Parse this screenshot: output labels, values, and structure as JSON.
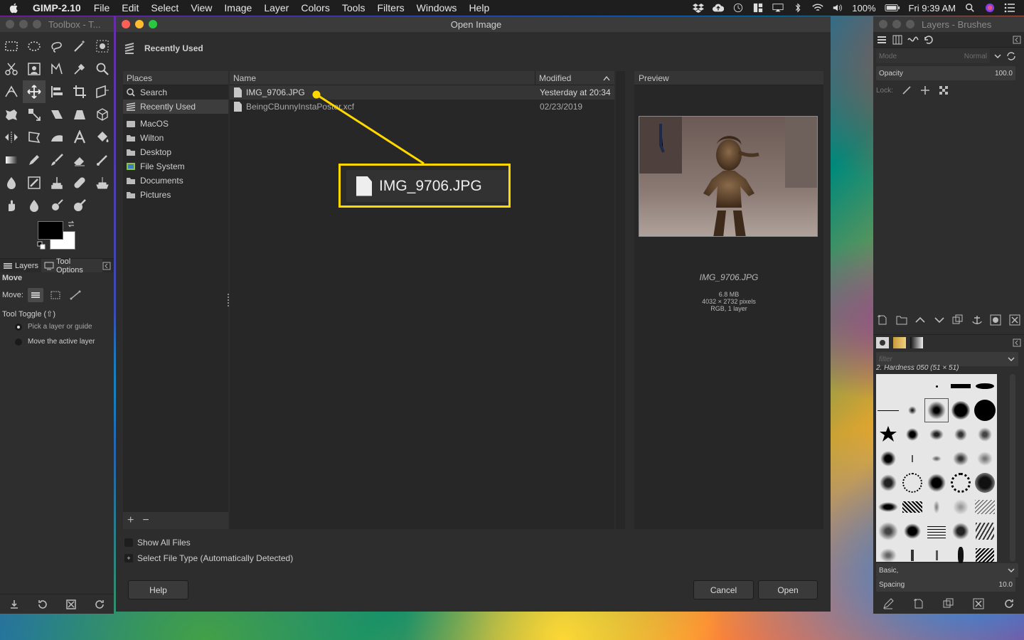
{
  "menubar": {
    "app_name": "GIMP-2.10",
    "items": [
      "File",
      "Edit",
      "Select",
      "View",
      "Image",
      "Layer",
      "Colors",
      "Tools",
      "Filters",
      "Windows",
      "Help"
    ],
    "battery": "100%",
    "clock": "Fri 9:39 AM"
  },
  "toolbox": {
    "title": "Toolbox - T...",
    "tabs": {
      "layers": "Layers",
      "tool_options": "Tool Options"
    },
    "tool_name": "Move",
    "move_label": "Move:",
    "tool_toggle": "Tool Toggle  (⇧)",
    "option_pick": "Pick a layer or guide",
    "option_move_active": "Move the active layer"
  },
  "dialog": {
    "title": "Open Image",
    "location": "Recently Used",
    "places_header": "Places",
    "places": [
      {
        "label": "Search",
        "icon": "search-icon"
      },
      {
        "label": "Recently Used",
        "icon": "recent-icon",
        "selected": true
      },
      {
        "label": "MacOS",
        "icon": "drive-icon"
      },
      {
        "label": "Wilton",
        "icon": "folder-icon"
      },
      {
        "label": "Desktop",
        "icon": "folder-icon"
      },
      {
        "label": "File System",
        "icon": "filesystem-icon"
      },
      {
        "label": "Documents",
        "icon": "folder-icon"
      },
      {
        "label": "Pictures",
        "icon": "folder-icon"
      }
    ],
    "columns": {
      "name": "Name",
      "modified": "Modified"
    },
    "files": [
      {
        "name": "IMG_9706.JPG",
        "modified": "Yesterday at 20:34"
      },
      {
        "name": "BeingCBunnyInstaPoster.xcf",
        "modified": "02/23/2019"
      }
    ],
    "preview_header": "Preview",
    "preview": {
      "name": "IMG_9706.JPG",
      "size": "6.8 MB",
      "dimensions": "4032 × 2732 pixels",
      "mode": "RGB, 1 layer"
    },
    "show_all_files": "Show All Files",
    "select_file_type": "Select File Type (Automatically Detected)",
    "help_button": "Help",
    "cancel_button": "Cancel",
    "open_button": "Open"
  },
  "callout": {
    "text": "IMG_9706.JPG",
    "color": "#ffd800"
  },
  "layers": {
    "title": "Layers - Brushes",
    "mode_label": "Mode",
    "mode_value": "Normal",
    "opacity_label": "Opacity",
    "opacity_value": "100.0",
    "lock_label": "Lock:",
    "filter_placeholder": "filter",
    "brush_name": "2. Hardness 050 (51 × 51)",
    "brush_set": "Basic,",
    "spacing_label": "Spacing",
    "spacing_value": "10.0"
  }
}
